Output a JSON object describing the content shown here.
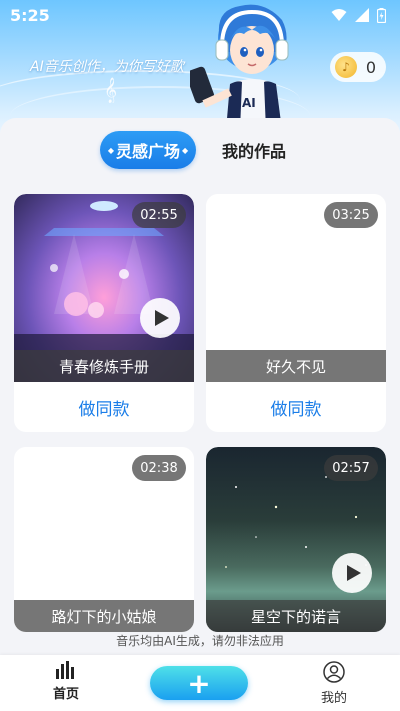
{
  "status_bar": {
    "time": "5:25"
  },
  "header": {
    "slogan": "AI音乐创作，为你写好歌",
    "coin_count": "0",
    "mascot_badge": "AI"
  },
  "tabs": [
    {
      "label": "灵感广场",
      "active": true
    },
    {
      "label": "我的作品",
      "active": false
    }
  ],
  "cards": [
    {
      "title": "青春修炼手册",
      "duration": "02:55",
      "action": "做同款"
    },
    {
      "title": "好久不见",
      "duration": "03:25",
      "action": "做同款"
    },
    {
      "title": "路灯下的小姑娘",
      "duration": "02:38"
    },
    {
      "title": "星空下的诺言",
      "duration": "02:57"
    }
  ],
  "notice": "音乐均由AI生成，请勿非法应用",
  "bottom_nav": {
    "home_label": "首页",
    "create_label": "+",
    "mine_label": "我的"
  },
  "colors": {
    "accent": "#1a7de8",
    "header_top": "#6ec6ff",
    "create_button": "#1aa0f0"
  }
}
